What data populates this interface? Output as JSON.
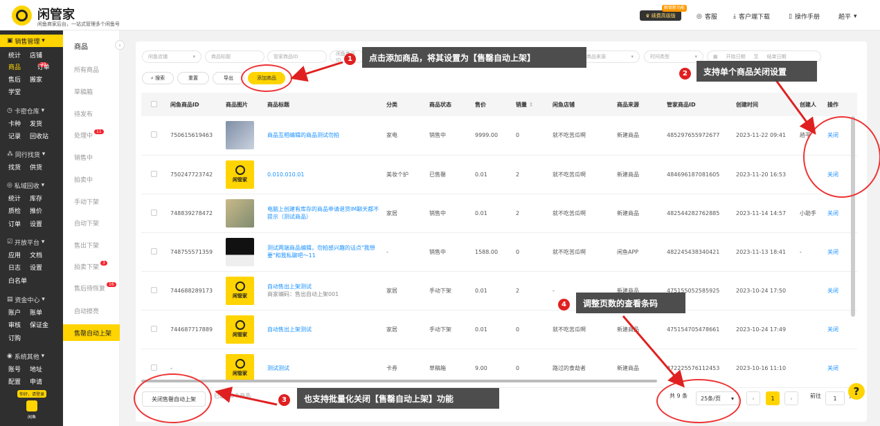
{
  "app": {
    "title": "闲管家",
    "subtitle": "闲鱼商家后台，一站式管理多个闲鱼号",
    "vip_label": "续费高级版",
    "vip_tag": "解锁新功能",
    "links": [
      "客服",
      "客户端下载",
      "操作手册"
    ],
    "user": "趟平"
  },
  "sidebar": {
    "sections": [
      {
        "title": "销售管理",
        "rows": [
          [
            "统计",
            "店铺"
          ],
          [
            "商品",
            "订单"
          ],
          [
            "售后",
            "搬家"
          ],
          [
            "学堂"
          ]
        ]
      },
      {
        "title": "卡密仓库",
        "rows": [
          [
            "卡种",
            "发货"
          ],
          [
            "记录",
            "回收站"
          ]
        ]
      },
      {
        "title": "同行找货",
        "rows": [
          [
            "找货",
            "供货"
          ]
        ]
      },
      {
        "title": "私域回收",
        "rows": [
          [
            "统计",
            "库存"
          ],
          [
            "质检",
            "推价"
          ],
          [
            "订单",
            "设置"
          ]
        ]
      },
      {
        "title": "开放平台",
        "rows": [
          [
            "应用",
            "文档"
          ],
          [
            "日志",
            "设置"
          ],
          [
            "白名单"
          ]
        ]
      },
      {
        "title": "资金中心",
        "rows": [
          [
            "账户",
            "账单"
          ],
          [
            "审核",
            "保证金"
          ],
          [
            "订购"
          ]
        ]
      },
      {
        "title": "系统其他",
        "rows": [
          [
            "账号",
            "地址"
          ],
          [
            "配置",
            "申请"
          ]
        ]
      }
    ],
    "goods_badge": "30",
    "promo_text": "你好，请登录",
    "promo_label": "闲鱼"
  },
  "submenu": {
    "title": "商品",
    "items": [
      {
        "label": "所有商品",
        "badge": ""
      },
      {
        "label": "草稿箱",
        "badge": ""
      },
      {
        "label": "待发布",
        "badge": ""
      },
      {
        "label": "处理中",
        "badge": "11"
      },
      {
        "label": "销售中",
        "badge": ""
      },
      {
        "label": "拍卖中",
        "badge": ""
      },
      {
        "label": "手动下架",
        "badge": ""
      },
      {
        "label": "自动下架",
        "badge": ""
      },
      {
        "label": "售出下架",
        "badge": ""
      },
      {
        "label": "拍卖下架",
        "badge": "3"
      },
      {
        "label": "售后待恢复",
        "badge": "16"
      },
      {
        "label": "自动擦亮",
        "badge": ""
      },
      {
        "label": "售罄自动上架",
        "badge": ""
      }
    ]
  },
  "filters": {
    "shop": "闲鱼店铺",
    "name": "商品标题",
    "mgr_id": "管家商品ID",
    "xianyu_id": "闲鱼商品ID",
    "source": "商品来源",
    "time_type": "时间类型",
    "start": "开始日期",
    "end": "结束日期",
    "sep": "至"
  },
  "buttons": {
    "search": "搜索",
    "reset": "重置",
    "export": "导出",
    "add": "添加商品"
  },
  "table": {
    "headers": [
      "闲鱼商品ID",
      "商品图片",
      "商品标题",
      "分类",
      "商品状态",
      "售价",
      "销量",
      "闲鱼店铺",
      "商品来源",
      "管家商品ID",
      "创建时间",
      "创建人",
      "操作"
    ],
    "rows": [
      {
        "id": "750615619463",
        "img": "p1",
        "title": "商品互相编辑的商品测试勿拍",
        "sub": "",
        "cat": "家电",
        "status": "销售中",
        "price": "9999.00",
        "sales": "0",
        "shop": "就不吃苦瓜啊",
        "source": "新建商品",
        "mgr_id": "485297655972677",
        "time": "2023-11-22 09:41",
        "creator": "趟平",
        "action": "关闭"
      },
      {
        "id": "750247723742",
        "img": "yl",
        "title": "0.010.010.01",
        "sub": "",
        "cat": "美妆个护",
        "status": "已售罄",
        "price": "0.01",
        "sales": "2",
        "shop": "就不吃苦瓜啊",
        "source": "新建商品",
        "mgr_id": "484696187081605",
        "time": "2023-11-20 16:53",
        "creator": "",
        "action": "关闭"
      },
      {
        "id": "748839278472",
        "img": "p2",
        "title": "电脑上创建有库存的商品申请退货IM聊天都不提示（测试商品）",
        "sub": "",
        "cat": "家居",
        "status": "销售中",
        "price": "0.01",
        "sales": "2",
        "shop": "就不吃苦瓜啊",
        "source": "新建商品",
        "mgr_id": "482544282762885",
        "time": "2023-11-14 14:57",
        "creator": "小助手",
        "action": "关闭"
      },
      {
        "id": "748755571359",
        "img": "p3",
        "title": "测试两端商品编辑，勿拍感兴趣的话点\"我想要\"和我私聊吧～11",
        "sub": "",
        "cat": "-",
        "status": "销售中",
        "price": "1588.00",
        "sales": "0",
        "shop": "就不吃苦瓜啊",
        "source": "闲鱼APP",
        "mgr_id": "482245438340421",
        "time": "2023-11-13 18:41",
        "creator": "-",
        "action": "关闭"
      },
      {
        "id": "744688289173",
        "img": "yl",
        "title": "自动售出上架测试",
        "sub": "商家编码：售出自动上架001",
        "cat": "家居",
        "status": "手动下架",
        "price": "0.01",
        "sales": "2",
        "shop": "-",
        "source": "新建商品",
        "mgr_id": "475155052585925",
        "time": "2023-10-24 17:50",
        "creator": "",
        "action": "关闭"
      },
      {
        "id": "744687717889",
        "img": "yl",
        "title": "自动售出上架测试",
        "sub": "",
        "cat": "家居",
        "status": "手动下架",
        "price": "0.01",
        "sales": "0",
        "shop": "就不吃苦瓜啊",
        "source": "新建商品",
        "mgr_id": "475154705478661",
        "time": "2023-10-24 17:49",
        "creator": "",
        "action": "关闭"
      },
      {
        "id": "-",
        "img": "yl",
        "title": "测试测试",
        "sub": "",
        "cat": "卡券",
        "status": "草稿箱",
        "price": "9.00",
        "sales": "0",
        "shop": "路过的食劫者",
        "source": "新建商品",
        "mgr_id": "472225576112453",
        "time": "2023-10-16 11:10",
        "creator": "",
        "action": "关闭"
      }
    ],
    "thumb_text": "闲管家"
  },
  "footer": {
    "batch_close": "关闭售罄自动上架",
    "selected": "已选中0个商品",
    "total": "共 9 条",
    "page_size": "25条/页",
    "current_page": "1",
    "goto_label": "前往",
    "goto_value": "1",
    "page_unit": "页"
  },
  "callouts": [
    {
      "num": "1",
      "text": "点击添加商品，将其设置为【售罄自动上架】"
    },
    {
      "num": "2",
      "text": "支持单个商品关闭设置"
    },
    {
      "num": "3",
      "text": "也支持批量化关闭【售罄自动上架】功能"
    },
    {
      "num": "4",
      "text": "调整页数的查看条码"
    }
  ],
  "colors": {
    "brand": "#ffd400",
    "sidebar": "#2f2f2f",
    "link": "#1890ff",
    "annotation": "#e02020"
  }
}
